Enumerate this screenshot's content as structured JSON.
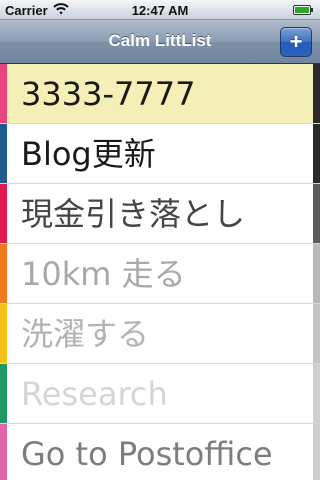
{
  "status_bar": {
    "carrier": "Carrier",
    "time": "12:47 AM",
    "wifi_icon": "wifi-icon",
    "battery_icon": "battery-icon"
  },
  "nav": {
    "title": "Calm LittList",
    "add_button": "+"
  },
  "items": [
    {
      "label": "3333-7777",
      "stripe": "#e8427f",
      "text_color": "#1a1a1a",
      "background": "#f3efb6",
      "edge": "#2a2a2a"
    },
    {
      "label": "Blog更新",
      "stripe": "#1d5c8c",
      "text_color": "#1a1a1a",
      "background": "#ffffff",
      "edge": "#2a2a2a"
    },
    {
      "label": "現金引き落とし",
      "stripe": "#e0194e",
      "text_color": "#444444",
      "background": "#ffffff",
      "edge": "#5a5a5a"
    },
    {
      "label": "10km 走る",
      "stripe": "#f07a1e",
      "text_color": "#a8a8a8",
      "background": "#ffffff",
      "edge": "#b8b8b8"
    },
    {
      "label": "洗濯する",
      "stripe": "#f2c21a",
      "text_color": "#b3b3b3",
      "background": "#ffffff",
      "edge": "#c4c4c4"
    },
    {
      "label": "Research",
      "stripe": "#1f9a64",
      "text_color": "#d5d5d5",
      "background": "#ffffff",
      "edge": "#d0d0d0"
    },
    {
      "label": "Go to Postoffice",
      "stripe": "#e066a8",
      "text_color": "#7d7d7d",
      "background": "#ffffff",
      "edge": "#cfcfcf"
    }
  ]
}
